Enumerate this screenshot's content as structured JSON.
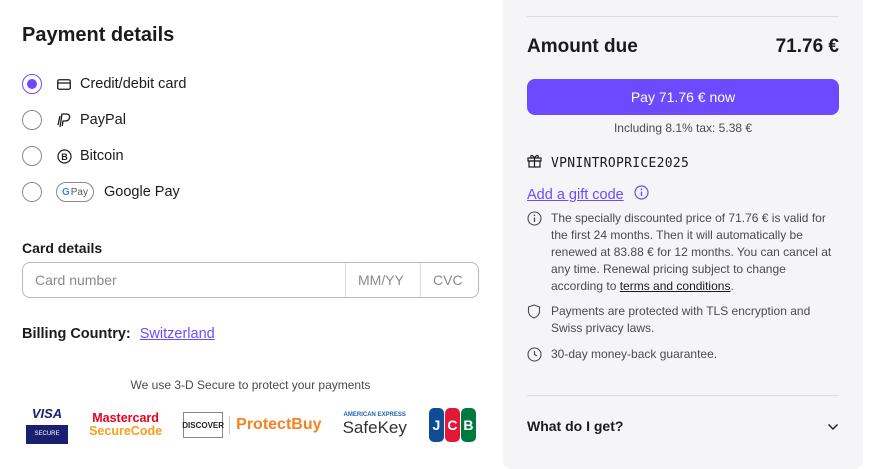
{
  "payment": {
    "title": "Payment details",
    "methods": [
      {
        "label": "Credit/debit card",
        "icon": "credit-card-icon",
        "selected": true
      },
      {
        "label": "PayPal",
        "icon": "paypal-icon",
        "selected": false
      },
      {
        "label": "Bitcoin",
        "icon": "bitcoin-icon",
        "selected": false
      },
      {
        "label": "Google Pay",
        "icon": "google-pay-icon",
        "selected": false
      }
    ],
    "gpay_badge": "Pay"
  },
  "card": {
    "label": "Card details",
    "number_placeholder": "Card number",
    "expiry_placeholder": "MM/YY",
    "cvc_placeholder": "CVC"
  },
  "billing": {
    "label": "Billing Country:",
    "country": "Switzerland"
  },
  "secure": {
    "text": "We use 3-D Secure to protect your payments",
    "visa_top": "VISA",
    "visa_bottom": "SECURE",
    "mc_line1": "Mastercard",
    "mc_line2": "SecureCode",
    "discover_badge": "DISCOVER",
    "protectbuy": "ProtectBuy",
    "amex_small": "AMERICAN EXPRESS",
    "safekey": "SafeKey",
    "jcb": [
      "J",
      "C",
      "B"
    ]
  },
  "summary": {
    "amount_label": "Amount due",
    "amount_value": "71.76 €",
    "pay_button": "Pay 71.76 € now",
    "tax_text": "Including 8.1% tax: 5.38 €",
    "promo_code": "VPNINTROPRICE2025",
    "gift_link": "Add a gift code",
    "info_discount_text": "The specially discounted price of 71.76 € is valid for the first 24 months. Then it will automatically be renewed at 83.88 € for 12 months. You can cancel at any time. Renewal pricing subject to change according to ",
    "info_terms_link": "terms and conditions",
    "info_period": ".",
    "info_security": "Payments are protected with TLS encryption and Swiss privacy laws.",
    "info_guarantee": "30-day money-back guarantee.",
    "what_get": "What do I get?"
  },
  "colors": {
    "accent": "#6d4aff",
    "panel_bg": "#f5f5f7"
  }
}
